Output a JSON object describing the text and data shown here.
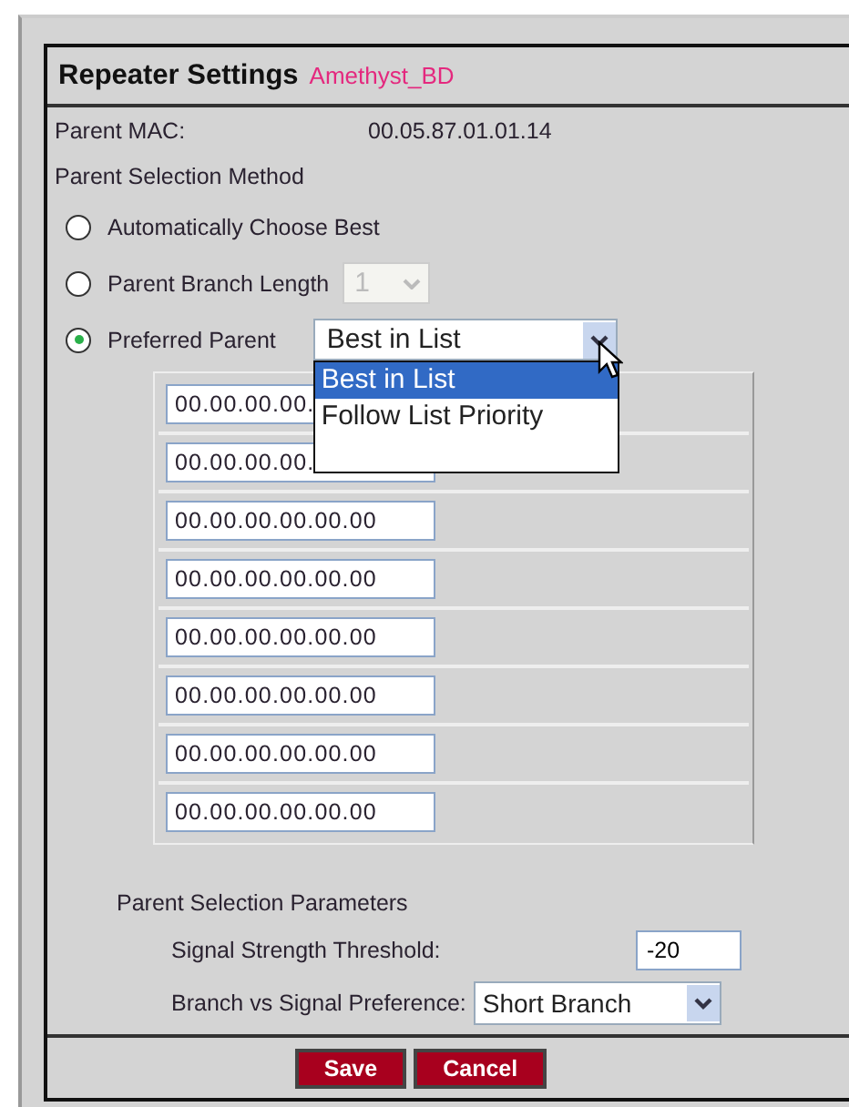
{
  "header": {
    "title": "Repeater Settings",
    "device": "Amethyst_BD"
  },
  "parent_mac": {
    "label": "Parent MAC:",
    "value": "00.05.87.01.01.14"
  },
  "method": {
    "label": "Parent Selection Method",
    "options": [
      {
        "label": "Automatically Choose Best",
        "selected": false,
        "kind": "plain"
      },
      {
        "label": "Parent Branch Length",
        "selected": false,
        "kind": "number",
        "control": {
          "value": "1",
          "disabled": true
        }
      },
      {
        "label": "Preferred Parent",
        "selected": true,
        "kind": "list",
        "control": {
          "value": "Best in List",
          "expanded": true,
          "options": [
            {
              "label": "Best in List",
              "selected": true
            },
            {
              "label": "Follow List Priority",
              "selected": false
            }
          ]
        }
      }
    ]
  },
  "preferred_macs": [
    "00.00.00.00.",
    "00.00.00.00.",
    "00.00.00.00.00.00",
    "00.00.00.00.00.00",
    "00.00.00.00.00.00",
    "00.00.00.00.00.00",
    "00.00.00.00.00.00",
    "00.00.00.00.00.00"
  ],
  "parameters": {
    "title": "Parent Selection Parameters",
    "threshold": {
      "label": "Signal Strength Threshold:",
      "value": "-20"
    },
    "preference": {
      "label": "Branch vs Signal Preference:",
      "value": "Short Branch"
    }
  },
  "buttons": [
    "Save",
    "Cancel"
  ]
}
